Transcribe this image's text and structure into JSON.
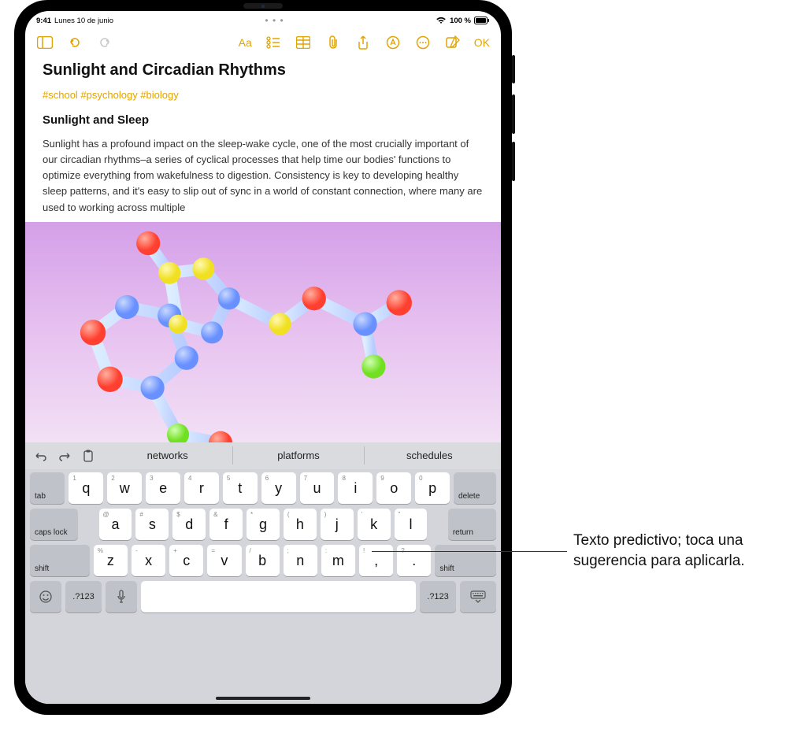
{
  "status": {
    "time": "9:41",
    "date": "Lunes 10 de junio",
    "battery_text": "100 %",
    "center_dots": "• • •"
  },
  "toolbar": {
    "format_label": "Aa",
    "done_label": "OK"
  },
  "note": {
    "title": "Sunlight and Circadian Rhythms",
    "tags": "#school #psychology #biology",
    "subtitle": "Sunlight and Sleep",
    "body": "Sunlight has a profound impact on the sleep-wake cycle, one of the most crucially important of our circadian rhythms–a series of cyclical processes that help time our bodies' functions to optimize everything from wakefulness to digestion. Consistency is key to developing healthy sleep patterns, and it's easy to slip out of sync in a world of constant connection, where many are used to working across multiple"
  },
  "predictive": {
    "suggestions": [
      "networks",
      "platforms",
      "schedules"
    ]
  },
  "keyboard": {
    "row1_alt": [
      "1",
      "2",
      "3",
      "4",
      "5",
      "6",
      "7",
      "8",
      "9",
      "0"
    ],
    "row1": [
      "q",
      "w",
      "e",
      "r",
      "t",
      "y",
      "u",
      "i",
      "o",
      "p"
    ],
    "row2_alt": [
      "@",
      "#",
      "$",
      "&",
      "*",
      "(",
      ")",
      "'",
      "\""
    ],
    "row2": [
      "a",
      "s",
      "d",
      "f",
      "g",
      "h",
      "j",
      "k",
      "l"
    ],
    "row3_alt": [
      "%",
      "-",
      "+",
      "=",
      "/",
      ";",
      ":",
      "!",
      "?"
    ],
    "row3": [
      "z",
      "x",
      "c",
      "v",
      "b",
      "n",
      "m",
      ",",
      "."
    ],
    "tab": "tab",
    "delete": "delete",
    "caps": "caps lock",
    "ret": "return",
    "shift": "shift",
    "sym": ".?123"
  },
  "callout": {
    "text": "Texto predictivo; toca una sugerencia para aplicarla."
  }
}
